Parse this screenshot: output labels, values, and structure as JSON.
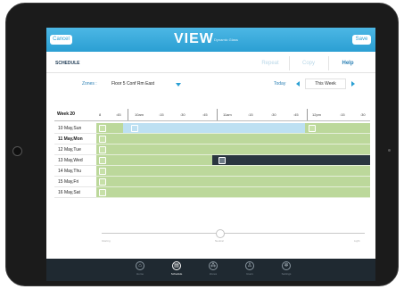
{
  "topbar": {
    "cancel_label": "Cancel",
    "save_label": "Save",
    "logo_text": "VIEW",
    "logo_sub": "Dynamic Glass"
  },
  "toolbar": {
    "schedule_label": "SCHEDULE",
    "repeat_label": "Repeat",
    "copy_label": "Copy",
    "help_label": "Help"
  },
  "filters": {
    "zones_label": "Zones :",
    "zone_value": "Floor 5 Conf Rm East",
    "today_label": "Today",
    "week_value": "This Week"
  },
  "grid": {
    "week_label": "Week 20",
    "time_ticks": [
      "8",
      ":45",
      "10am",
      ":15",
      ":30",
      ":45",
      "11am",
      ":15",
      ":30",
      ":45",
      "12pm",
      ":15",
      ":30"
    ],
    "days": [
      {
        "label": "10 May,Sun",
        "bold": false
      },
      {
        "label": "11 May,Mon",
        "bold": true
      },
      {
        "label": "12 May,Tue",
        "bold": false
      },
      {
        "label": "13 May,Wed",
        "bold": false
      },
      {
        "label": "14 May,Thu",
        "bold": false
      },
      {
        "label": "15 May,Fri",
        "bold": false
      },
      {
        "label": "16 May,Sat",
        "bold": false
      }
    ],
    "colors": {
      "green": "#bcd89b",
      "blue": "#bde0f2",
      "dark": "#2a3640"
    }
  },
  "slider": {
    "left_label": "Glaring",
    "mid_label": "Neutral",
    "right_label": "Light",
    "value": 0.45
  },
  "tabs": [
    {
      "label": "Home",
      "icon": "home-icon",
      "glyph": "⌂"
    },
    {
      "label": "Schedule",
      "icon": "schedule-icon",
      "glyph": "▤"
    },
    {
      "label": "Zones",
      "icon": "zones-icon",
      "glyph": "⁂"
    },
    {
      "label": "Users",
      "icon": "user-icon",
      "glyph": "♙"
    },
    {
      "label": "Settings",
      "icon": "gear-icon",
      "glyph": "✲"
    }
  ]
}
